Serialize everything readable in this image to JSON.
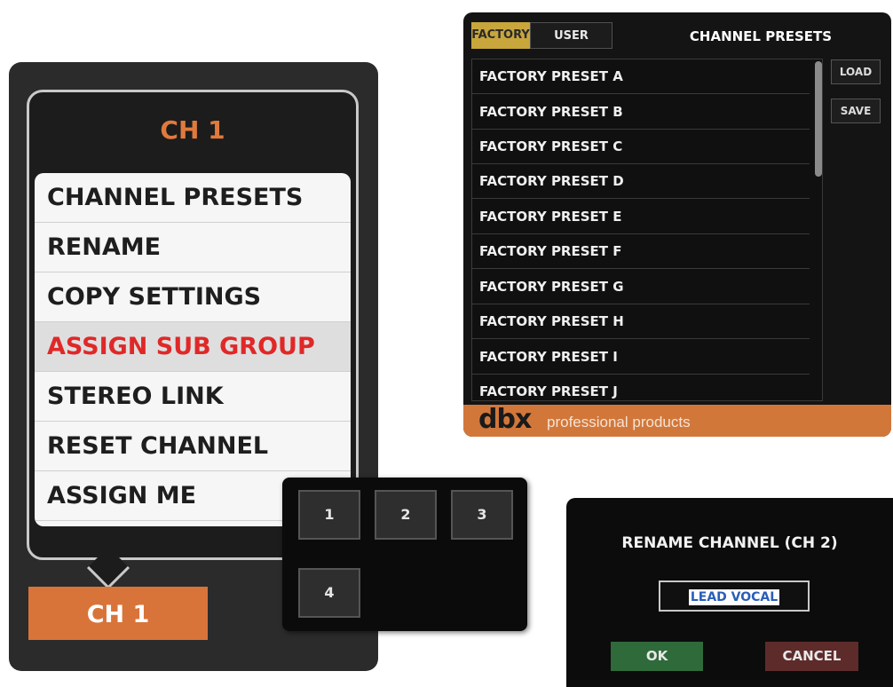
{
  "channel_menu": {
    "header": "CH 1",
    "items": [
      {
        "label": "CHANNEL PRESETS",
        "active": false
      },
      {
        "label": "RENAME",
        "active": false
      },
      {
        "label": "COPY SETTINGS",
        "active": false
      },
      {
        "label": "ASSIGN SUB GROUP",
        "active": true
      },
      {
        "label": "STEREO LINK",
        "active": false
      },
      {
        "label": "RESET CHANNEL",
        "active": false
      },
      {
        "label": "ASSIGN ME",
        "active": false
      }
    ],
    "footer": "CH 1"
  },
  "sub_group_picker": {
    "buttons": [
      "1",
      "2",
      "3",
      "4"
    ]
  },
  "channel_presets": {
    "tabs": [
      {
        "label": "FACTORY",
        "selected": true
      },
      {
        "label": "USER",
        "selected": false
      }
    ],
    "title": "CHANNEL PRESETS",
    "presets": [
      "FACTORY PRESET A",
      "FACTORY PRESET B",
      "FACTORY PRESET C",
      "FACTORY PRESET D",
      "FACTORY PRESET E",
      "FACTORY PRESET F",
      "FACTORY PRESET G",
      "FACTORY PRESET H",
      "FACTORY PRESET I",
      "FACTORY PRESET J"
    ],
    "load_label": "LOAD",
    "save_label": "SAVE",
    "brand": {
      "logo": "dbx",
      "tagline": "professional products"
    }
  },
  "rename_dialog": {
    "title": "RENAME CHANNEL (CH 2)",
    "value": "LEAD VOCAL",
    "ok_label": "OK",
    "cancel_label": "CANCEL"
  },
  "colors": {
    "accent_orange": "#d8743a",
    "active_red": "#e02828",
    "factory_tab": "#c8a63c",
    "ok_green": "#2f6a3a",
    "cancel_red": "#5e2b2b"
  }
}
